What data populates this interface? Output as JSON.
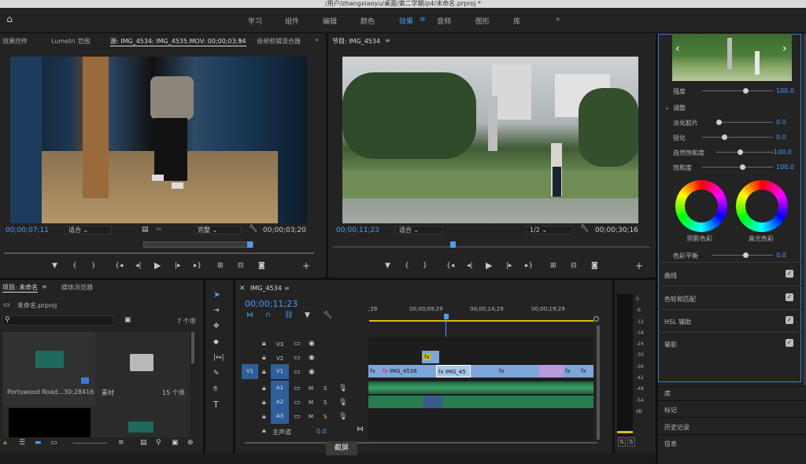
{
  "app": {
    "title": "/用户/zhangxiaoyu/桌面/第二学期/p4/未命名.prproj *"
  },
  "workspaces": {
    "items": [
      "学习",
      "组件",
      "编辑",
      "颜色",
      "效果",
      "音频",
      "图形",
      "库"
    ],
    "active": "效果"
  },
  "source": {
    "tabs": [
      "效果控件",
      "Lumetri 范围",
      "源: IMG_4534: IMG_4535.MOV: 00;00;03;14",
      "音频剪辑混合器"
    ],
    "timecode": "00;00;07;11",
    "fit": "适合",
    "quality": "完整",
    "duration": "00;00;03;20"
  },
  "program": {
    "tab": "节目: IMG_4534",
    "timecode": "00;00;11;23",
    "fit": "适合",
    "quality": "1/2",
    "duration": "00;00;30;16"
  },
  "lumetri": {
    "intensity_label": "强度",
    "intensity_value": "100.0",
    "adjust_label": "调整",
    "faded_label": "淡化胶片",
    "faded_value": "0.0",
    "sharpen_label": "锐化",
    "sharpen_value": "0.0",
    "vibrance_label": "自然饱和度",
    "vibrance_value": "-100.0",
    "saturation_label": "饱和度",
    "saturation_value": "100.0",
    "shadow_label": "阴影色彩",
    "highlight_label": "高光色彩",
    "balance_label": "色彩平衡",
    "balance_value": "0.0",
    "sections": [
      "曲线",
      "色轮和匹配",
      "HSL 辅助",
      "晕影"
    ]
  },
  "side_panels": [
    "库",
    "标记",
    "历史记录",
    "信息"
  ],
  "project": {
    "tabs": [
      "项目: 未命名",
      "媒体浏览器"
    ],
    "file": "未命名.prproj",
    "count": "7 个项",
    "items": [
      {
        "name": "Portswood Road...",
        "meta": "30:28416"
      },
      {
        "name": "素材",
        "meta": "15 个项"
      }
    ]
  },
  "timeline": {
    "tab": "IMG_4534",
    "timecode": "00;00;11;23",
    "ruler": [
      ";29",
      "00;00;09;29",
      "00;00;14;29",
      "00;00;19;29"
    ],
    "tracks": [
      "V3",
      "V2",
      "V1",
      "A1",
      "A2",
      "A3"
    ],
    "src_v": "V1",
    "master": "主声道",
    "master_val": "0.0",
    "clips": [
      "IMG_4538",
      "IMG_45"
    ]
  },
  "meter": {
    "labels": [
      "0",
      "-6",
      "-12",
      "-18",
      "-24",
      "-30",
      "-36",
      "-42",
      "-48",
      "-54",
      "dB"
    ]
  },
  "tooltip": "截屏"
}
